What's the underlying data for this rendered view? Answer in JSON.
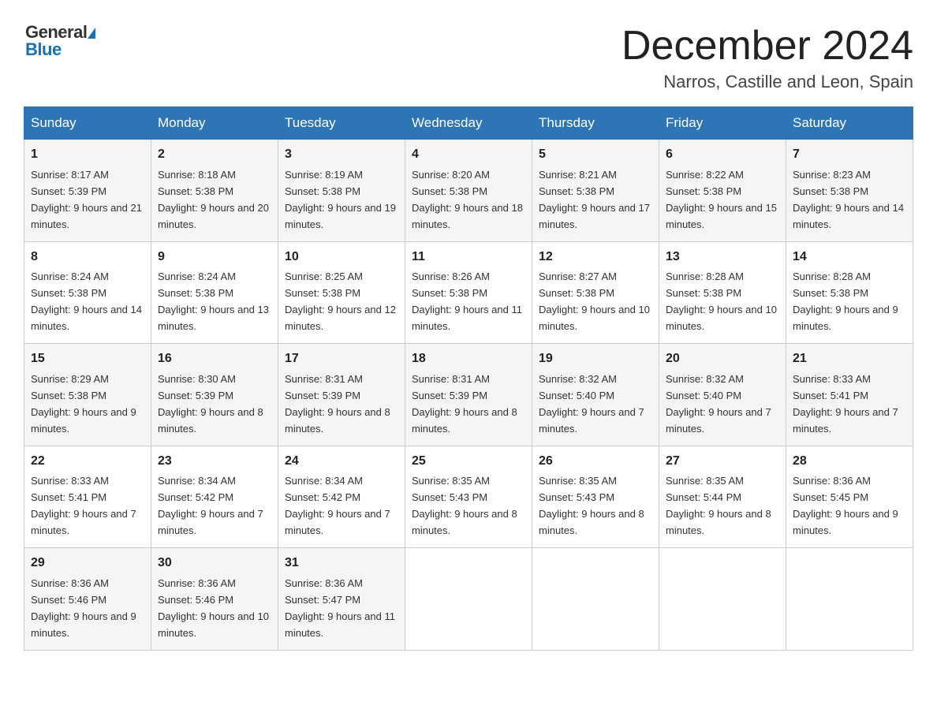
{
  "header": {
    "logo_general": "General",
    "logo_blue": "Blue",
    "month_year": "December 2024",
    "location": "Narros, Castille and Leon, Spain"
  },
  "days_of_week": [
    "Sunday",
    "Monday",
    "Tuesday",
    "Wednesday",
    "Thursday",
    "Friday",
    "Saturday"
  ],
  "weeks": [
    [
      {
        "day": "1",
        "sunrise": "8:17 AM",
        "sunset": "5:39 PM",
        "daylight": "9 hours and 21 minutes."
      },
      {
        "day": "2",
        "sunrise": "8:18 AM",
        "sunset": "5:38 PM",
        "daylight": "9 hours and 20 minutes."
      },
      {
        "day": "3",
        "sunrise": "8:19 AM",
        "sunset": "5:38 PM",
        "daylight": "9 hours and 19 minutes."
      },
      {
        "day": "4",
        "sunrise": "8:20 AM",
        "sunset": "5:38 PM",
        "daylight": "9 hours and 18 minutes."
      },
      {
        "day": "5",
        "sunrise": "8:21 AM",
        "sunset": "5:38 PM",
        "daylight": "9 hours and 17 minutes."
      },
      {
        "day": "6",
        "sunrise": "8:22 AM",
        "sunset": "5:38 PM",
        "daylight": "9 hours and 15 minutes."
      },
      {
        "day": "7",
        "sunrise": "8:23 AM",
        "sunset": "5:38 PM",
        "daylight": "9 hours and 14 minutes."
      }
    ],
    [
      {
        "day": "8",
        "sunrise": "8:24 AM",
        "sunset": "5:38 PM",
        "daylight": "9 hours and 14 minutes."
      },
      {
        "day": "9",
        "sunrise": "8:24 AM",
        "sunset": "5:38 PM",
        "daylight": "9 hours and 13 minutes."
      },
      {
        "day": "10",
        "sunrise": "8:25 AM",
        "sunset": "5:38 PM",
        "daylight": "9 hours and 12 minutes."
      },
      {
        "day": "11",
        "sunrise": "8:26 AM",
        "sunset": "5:38 PM",
        "daylight": "9 hours and 11 minutes."
      },
      {
        "day": "12",
        "sunrise": "8:27 AM",
        "sunset": "5:38 PM",
        "daylight": "9 hours and 10 minutes."
      },
      {
        "day": "13",
        "sunrise": "8:28 AM",
        "sunset": "5:38 PM",
        "daylight": "9 hours and 10 minutes."
      },
      {
        "day": "14",
        "sunrise": "8:28 AM",
        "sunset": "5:38 PM",
        "daylight": "9 hours and 9 minutes."
      }
    ],
    [
      {
        "day": "15",
        "sunrise": "8:29 AM",
        "sunset": "5:38 PM",
        "daylight": "9 hours and 9 minutes."
      },
      {
        "day": "16",
        "sunrise": "8:30 AM",
        "sunset": "5:39 PM",
        "daylight": "9 hours and 8 minutes."
      },
      {
        "day": "17",
        "sunrise": "8:31 AM",
        "sunset": "5:39 PM",
        "daylight": "9 hours and 8 minutes."
      },
      {
        "day": "18",
        "sunrise": "8:31 AM",
        "sunset": "5:39 PM",
        "daylight": "9 hours and 8 minutes."
      },
      {
        "day": "19",
        "sunrise": "8:32 AM",
        "sunset": "5:40 PM",
        "daylight": "9 hours and 7 minutes."
      },
      {
        "day": "20",
        "sunrise": "8:32 AM",
        "sunset": "5:40 PM",
        "daylight": "9 hours and 7 minutes."
      },
      {
        "day": "21",
        "sunrise": "8:33 AM",
        "sunset": "5:41 PM",
        "daylight": "9 hours and 7 minutes."
      }
    ],
    [
      {
        "day": "22",
        "sunrise": "8:33 AM",
        "sunset": "5:41 PM",
        "daylight": "9 hours and 7 minutes."
      },
      {
        "day": "23",
        "sunrise": "8:34 AM",
        "sunset": "5:42 PM",
        "daylight": "9 hours and 7 minutes."
      },
      {
        "day": "24",
        "sunrise": "8:34 AM",
        "sunset": "5:42 PM",
        "daylight": "9 hours and 7 minutes."
      },
      {
        "day": "25",
        "sunrise": "8:35 AM",
        "sunset": "5:43 PM",
        "daylight": "9 hours and 8 minutes."
      },
      {
        "day": "26",
        "sunrise": "8:35 AM",
        "sunset": "5:43 PM",
        "daylight": "9 hours and 8 minutes."
      },
      {
        "day": "27",
        "sunrise": "8:35 AM",
        "sunset": "5:44 PM",
        "daylight": "9 hours and 8 minutes."
      },
      {
        "day": "28",
        "sunrise": "8:36 AM",
        "sunset": "5:45 PM",
        "daylight": "9 hours and 9 minutes."
      }
    ],
    [
      {
        "day": "29",
        "sunrise": "8:36 AM",
        "sunset": "5:46 PM",
        "daylight": "9 hours and 9 minutes."
      },
      {
        "day": "30",
        "sunrise": "8:36 AM",
        "sunset": "5:46 PM",
        "daylight": "9 hours and 10 minutes."
      },
      {
        "day": "31",
        "sunrise": "8:36 AM",
        "sunset": "5:47 PM",
        "daylight": "9 hours and 11 minutes."
      },
      null,
      null,
      null,
      null
    ]
  ],
  "labels": {
    "sunrise_prefix": "Sunrise: ",
    "sunset_prefix": "Sunset: ",
    "daylight_prefix": "Daylight: "
  }
}
